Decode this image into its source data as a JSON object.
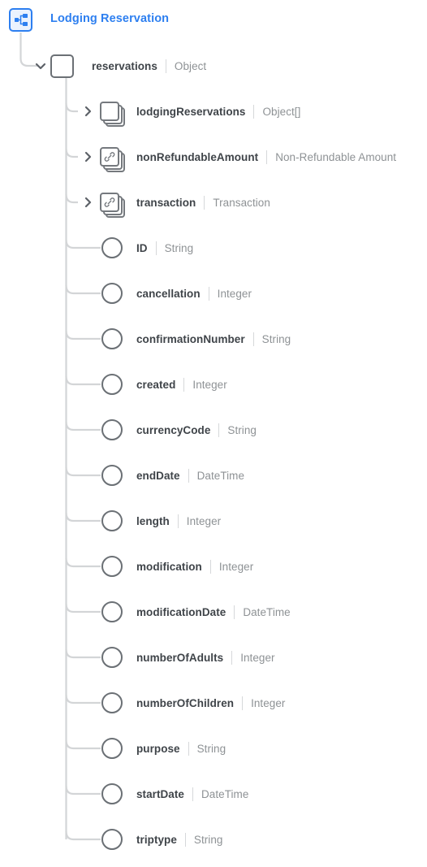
{
  "header": {
    "title": "Lodging Reservation",
    "icon": "schema-tree-icon",
    "accent_color": "#2d7ff0"
  },
  "colors": {
    "accent": "#2d7ff0",
    "accent_fill": "#eaf2fe",
    "node_stroke": "#6b7075",
    "connector": "#d3d5d7",
    "name_text": "#3f4449",
    "type_text": "#8e9295",
    "separator": "#d6d8da"
  },
  "tree": {
    "root": {
      "name": "reservations",
      "type": "Object",
      "node_kind": "object-box",
      "toggle": "chevron-down-icon",
      "expanded": true
    },
    "children": [
      {
        "name": "lodgingReservations",
        "type": "Object[]",
        "node_kind": "stacked-cards",
        "glyph": "none",
        "toggle": "chevron-right-icon",
        "expanded": false
      },
      {
        "name": "nonRefundableAmount",
        "type": "Non-Refundable Amount",
        "node_kind": "stacked-cards",
        "glyph": "link-icon",
        "toggle": "chevron-right-icon",
        "expanded": false
      },
      {
        "name": "transaction",
        "type": "Transaction",
        "node_kind": "stacked-cards",
        "glyph": "link-icon",
        "toggle": "chevron-right-icon",
        "expanded": false
      },
      {
        "name": "ID",
        "type": "String",
        "node_kind": "circle"
      },
      {
        "name": "cancellation",
        "type": "Integer",
        "node_kind": "circle"
      },
      {
        "name": "confirmationNumber",
        "type": "String",
        "node_kind": "circle"
      },
      {
        "name": "created",
        "type": "Integer",
        "node_kind": "circle"
      },
      {
        "name": "currencyCode",
        "type": "String",
        "node_kind": "circle"
      },
      {
        "name": "endDate",
        "type": "DateTime",
        "node_kind": "circle"
      },
      {
        "name": "length",
        "type": "Integer",
        "node_kind": "circle"
      },
      {
        "name": "modification",
        "type": "Integer",
        "node_kind": "circle"
      },
      {
        "name": "modificationDate",
        "type": "DateTime",
        "node_kind": "circle"
      },
      {
        "name": "numberOfAdults",
        "type": "Integer",
        "node_kind": "circle"
      },
      {
        "name": "numberOfChildren",
        "type": "Integer",
        "node_kind": "circle"
      },
      {
        "name": "purpose",
        "type": "String",
        "node_kind": "circle"
      },
      {
        "name": "startDate",
        "type": "DateTime",
        "node_kind": "circle"
      },
      {
        "name": "triptype",
        "type": "String",
        "node_kind": "circle"
      }
    ]
  }
}
